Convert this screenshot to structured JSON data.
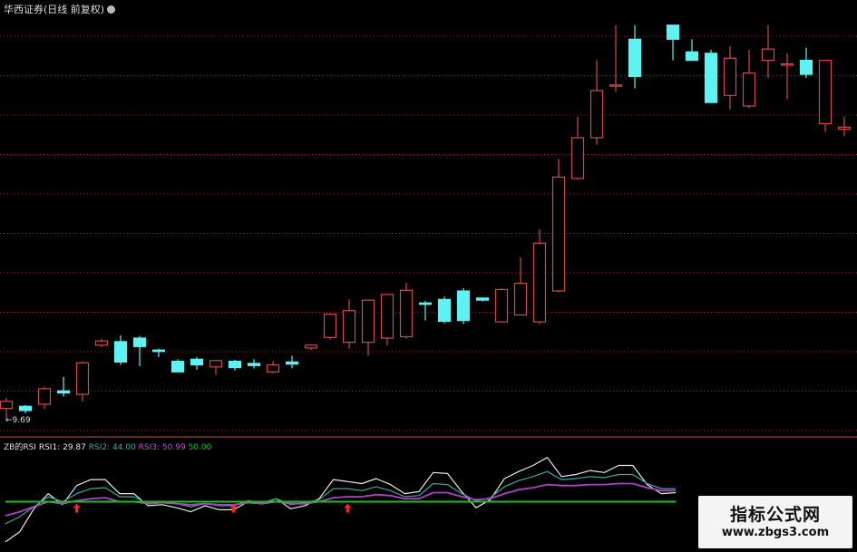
{
  "header": {
    "title": "华西证券(日线 前复权)",
    "indicator_name": "ZB的RSI",
    "rsi1_label": "RSI1:",
    "rsi1_value": "29.87",
    "rsi2_label": "RSI2:",
    "rsi2_value": "44.00",
    "rsi3_label": "RSI3:",
    "rsi3_value": "50.99",
    "level_value": "50.00"
  },
  "low_marker": "9.69",
  "watermark": {
    "name": "指标公式网",
    "url": "www.zbgs3.com"
  },
  "colors": {
    "up": "#d14b4b",
    "down": "#5ef2f2",
    "gridline": "#8a2525",
    "separator": "#c05a2a",
    "rsi1": "#e8e8e8",
    "rsi2": "#3aa8a0",
    "rsi3": "#b040c8",
    "level": "#19c419",
    "signal": "#ff2424"
  },
  "chart_data": [
    {
      "type": "candlestick",
      "x": [
        1,
        2,
        3,
        4,
        5,
        6,
        7,
        8,
        9,
        10,
        11,
        12,
        13,
        14,
        15,
        16,
        17,
        18,
        19,
        20,
        21,
        22,
        23,
        24,
        25,
        26,
        27,
        28,
        29,
        30,
        31,
        32,
        33,
        34,
        36,
        37,
        38,
        39,
        40,
        41,
        42,
        43,
        44,
        45
      ],
      "open": [
        9.85,
        9.88,
        9.91,
        10.1,
        10.05,
        10.75,
        10.8,
        10.85,
        10.68,
        10.52,
        10.55,
        10.44,
        10.52,
        10.49,
        10.37,
        10.51,
        10.71,
        10.86,
        10.79,
        10.79,
        10.85,
        10.87,
        11.35,
        11.4,
        11.52,
        11.42,
        11.08,
        11.18,
        11.08,
        11.52,
        13.12,
        13.7,
        14.45,
        15.1,
        15.3,
        14.92,
        14.9,
        14.3,
        14.15,
        14.8,
        14.75,
        14.8,
        13.9,
        13.82
      ],
      "close": [
        9.95,
        9.82,
        10.13,
        10.07,
        10.5,
        10.81,
        10.51,
        10.73,
        10.66,
        10.37,
        10.47,
        10.53,
        10.43,
        10.46,
        10.47,
        10.48,
        10.75,
        11.19,
        11.24,
        11.39,
        11.47,
        11.53,
        11.33,
        11.09,
        11.1,
        11.39,
        11.54,
        11.63,
        12.2,
        13.14,
        13.7,
        14.37,
        14.45,
        14.57,
        15.1,
        14.8,
        14.2,
        14.83,
        14.62,
        14.96,
        14.75,
        14.6,
        14.8,
        13.85
      ],
      "high": [
        10.0,
        9.9,
        10.16,
        10.3,
        10.52,
        10.84,
        10.89,
        10.88,
        10.7,
        10.55,
        10.58,
        10.54,
        10.54,
        10.55,
        10.52,
        10.6,
        10.76,
        11.2,
        11.4,
        11.4,
        11.48,
        11.64,
        11.38,
        11.44,
        11.56,
        11.42,
        11.56,
        12.0,
        12.4,
        13.4,
        14.0,
        14.8,
        15.3,
        15.3,
        15.3,
        15.1,
        14.95,
        15.0,
        14.95,
        15.3,
        14.9,
        14.98,
        14.8,
        14.0
      ],
      "low": [
        9.69,
        9.78,
        9.84,
        10.02,
        9.95,
        10.72,
        10.47,
        10.45,
        10.58,
        10.38,
        10.4,
        10.33,
        10.39,
        10.42,
        10.35,
        10.42,
        10.68,
        10.83,
        10.7,
        10.6,
        10.75,
        10.84,
        11.1,
        11.06,
        11.05,
        11.37,
        11.07,
        11.17,
        11.05,
        11.5,
        13.1,
        13.6,
        14.35,
        14.4,
        14.8,
        14.92,
        14.9,
        14.1,
        14.12,
        14.55,
        14.25,
        14.55,
        13.78,
        13.72
      ]
    },
    {
      "type": "line",
      "title": "ZB的RSI",
      "series": [
        {
          "name": "RSI1",
          "values": [
            10,
            20,
            43,
            58,
            47,
            66,
            72,
            72,
            58,
            58,
            46,
            47,
            44,
            40,
            46,
            42,
            42,
            50,
            48,
            53,
            43,
            46,
            53,
            72,
            70,
            68,
            73,
            67,
            58,
            60,
            79,
            78,
            60,
            44,
            52,
            73,
            80,
            86,
            94,
            75,
            77,
            81,
            79,
            86,
            86,
            67,
            58,
            59
          ]
        },
        {
          "name": "RSI2",
          "values": [
            28,
            35,
            45,
            55,
            50,
            58,
            63,
            64,
            55,
            55,
            48,
            50,
            48,
            45,
            48,
            46,
            46,
            51,
            49,
            53,
            47,
            49,
            52,
            63,
            63,
            61,
            65,
            61,
            55,
            56,
            68,
            67,
            58,
            51,
            54,
            65,
            71,
            75,
            80,
            72,
            73,
            75,
            74,
            77,
            77,
            68,
            63,
            63
          ]
        },
        {
          "name": "RSI3",
          "values": [
            36,
            40,
            45,
            50,
            48,
            51,
            53,
            54,
            50,
            50,
            48,
            49,
            48,
            47,
            48,
            47,
            47,
            49,
            48,
            50,
            48,
            48,
            50,
            54,
            55,
            55,
            57,
            56,
            53,
            53,
            59,
            59,
            55,
            52,
            53,
            58,
            62,
            64,
            67,
            66,
            66,
            67,
            67,
            68,
            68,
            64,
            61,
            61
          ]
        },
        {
          "name": "level",
          "values": [
            50,
            50,
            50,
            50,
            50,
            50,
            50,
            50,
            50,
            50,
            50,
            50,
            50,
            50,
            50,
            50,
            50,
            50,
            50,
            50,
            50,
            50,
            50,
            50,
            50,
            50,
            50,
            50,
            50,
            50,
            50,
            50,
            50,
            50,
            50,
            50,
            50,
            50,
            50,
            50,
            50,
            50,
            50,
            50,
            50,
            50,
            50,
            50
          ]
        }
      ],
      "signals": [
        5,
        16,
        24
      ]
    }
  ]
}
